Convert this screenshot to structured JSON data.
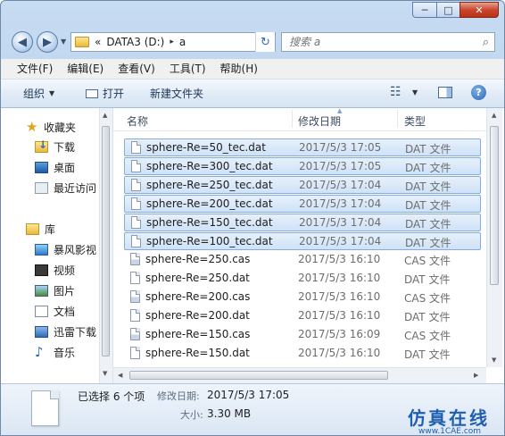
{
  "window": {
    "caption": {
      "minimize": "─",
      "maximize": "□",
      "close": "✕"
    }
  },
  "address": {
    "overflow": "«",
    "segments": [
      "DATA3 (D:)",
      "a"
    ],
    "separator": "▸"
  },
  "search": {
    "placeholder": "搜索 a"
  },
  "menu": [
    "文件(F)",
    "编辑(E)",
    "查看(V)",
    "工具(T)",
    "帮助(H)"
  ],
  "toolbar": {
    "organize": "组织",
    "open": "打开",
    "new_folder": "新建文件夹",
    "help": "?"
  },
  "nav": {
    "favorites": "收藏夹",
    "favorites_items": [
      "下载",
      "桌面",
      "最近访问"
    ],
    "libraries": "库",
    "library_items": [
      "暴风影视",
      "视频",
      "图片",
      "文档",
      "迅雷下载",
      "音乐"
    ]
  },
  "columns": {
    "name": "名称",
    "date": "修改日期",
    "type": "类型"
  },
  "files": [
    {
      "name": "sphere-Re=50_tec.dat",
      "date": "2017/5/3 17:05",
      "type": "DAT 文件",
      "selected": true,
      "kind": "dat"
    },
    {
      "name": "sphere-Re=300_tec.dat",
      "date": "2017/5/3 17:05",
      "type": "DAT 文件",
      "selected": true,
      "kind": "dat"
    },
    {
      "name": "sphere-Re=250_tec.dat",
      "date": "2017/5/3 17:04",
      "type": "DAT 文件",
      "selected": true,
      "kind": "dat"
    },
    {
      "name": "sphere-Re=200_tec.dat",
      "date": "2017/5/3 17:04",
      "type": "DAT 文件",
      "selected": true,
      "kind": "dat"
    },
    {
      "name": "sphere-Re=150_tec.dat",
      "date": "2017/5/3 17:04",
      "type": "DAT 文件",
      "selected": true,
      "kind": "dat"
    },
    {
      "name": "sphere-Re=100_tec.dat",
      "date": "2017/5/3 17:04",
      "type": "DAT 文件",
      "selected": true,
      "kind": "dat"
    },
    {
      "name": "sphere-Re=250.cas",
      "date": "2017/5/3 16:10",
      "type": "CAS 文件",
      "selected": false,
      "kind": "cas"
    },
    {
      "name": "sphere-Re=250.dat",
      "date": "2017/5/3 16:10",
      "type": "DAT 文件",
      "selected": false,
      "kind": "dat"
    },
    {
      "name": "sphere-Re=200.cas",
      "date": "2017/5/3 16:10",
      "type": "CAS 文件",
      "selected": false,
      "kind": "cas"
    },
    {
      "name": "sphere-Re=200.dat",
      "date": "2017/5/3 16:10",
      "type": "DAT 文件",
      "selected": false,
      "kind": "dat"
    },
    {
      "name": "sphere-Re=150.cas",
      "date": "2017/5/3 16:09",
      "type": "CAS 文件",
      "selected": false,
      "kind": "cas"
    },
    {
      "name": "sphere-Re=150.dat",
      "date": "2017/5/3 16:10",
      "type": "DAT 文件",
      "selected": false,
      "kind": "dat"
    }
  ],
  "details": {
    "selected_count": "已选择 6 个项",
    "modified_label": "修改日期:",
    "modified_value": "2017/5/3 17:05",
    "size_label": "大小:",
    "size_value": "3.30 MB"
  },
  "watermark": {
    "logo": "仿真在线",
    "url": "www.1CAE.com"
  },
  "colors": {
    "selection_bg": "#cfe2f7",
    "selection_border": "#84acdd",
    "chrome": "#b9d1ec",
    "brand": "#1f5fb0"
  }
}
